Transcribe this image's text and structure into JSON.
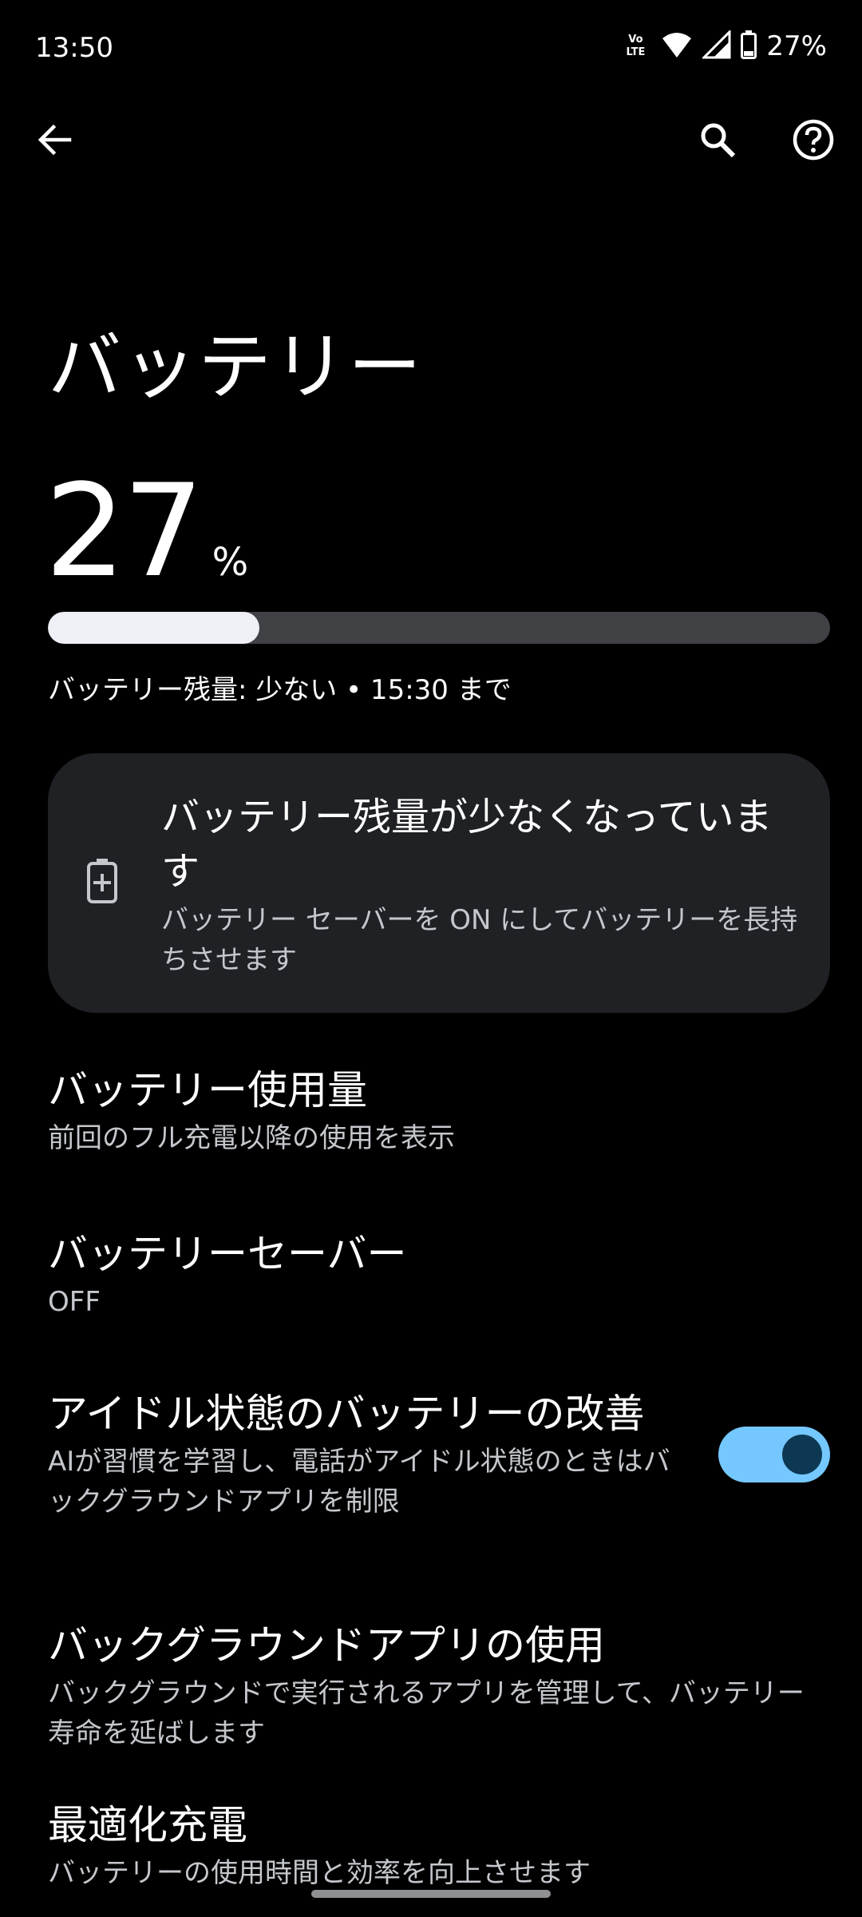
{
  "status_bar": {
    "time": "13:50",
    "volte_line1": "Vo",
    "volte_line2": "LTE",
    "battery_text": "27%",
    "icons": [
      "volte-icon",
      "wifi-icon",
      "signal-icon",
      "battery-icon"
    ]
  },
  "app_bar": {
    "icons": [
      "back-arrow-icon",
      "search-icon",
      "help-icon"
    ]
  },
  "page": {
    "title": "バッテリー"
  },
  "battery": {
    "level": "27",
    "unit": "%",
    "fill_fraction": 0.27,
    "status_text": "バッテリー残量: 少ない • 15:30 まで"
  },
  "warning_card": {
    "icon": "battery-plus-icon",
    "title": "バッテリー残量が少なくなっています",
    "subtitle": "バッテリー セーバーを ON にしてバッテリーを長持ちさせます"
  },
  "items": [
    {
      "title": "バッテリー使用量",
      "subtitle": "前回のフル充電以降の使用を表示"
    },
    {
      "title": "バッテリーセーバー",
      "subtitle": "OFF"
    },
    {
      "title": "アイドル状態のバッテリーの改善",
      "subtitle": "AIが習慣を学習し、電話がアイドル状態のときはバックグラウンドアプリを制限",
      "toggle_on": true
    },
    {
      "title": "バックグラウンドアプリの使用",
      "subtitle": "バックグラウンドで実行されるアプリを管理して、バッテリー寿命を延ばします"
    },
    {
      "title": "最適化充電",
      "subtitle": "バッテリーの使用時間と効率を向上させます"
    }
  ],
  "colors": {
    "background": "#000000",
    "card": "#1f2124",
    "toggle_track": "#75c8ff",
    "toggle_thumb": "#0d3853",
    "bar_fill": "#eef0f6",
    "bar_track": "#3f4145",
    "secondary_text": "#c4c7cc"
  }
}
